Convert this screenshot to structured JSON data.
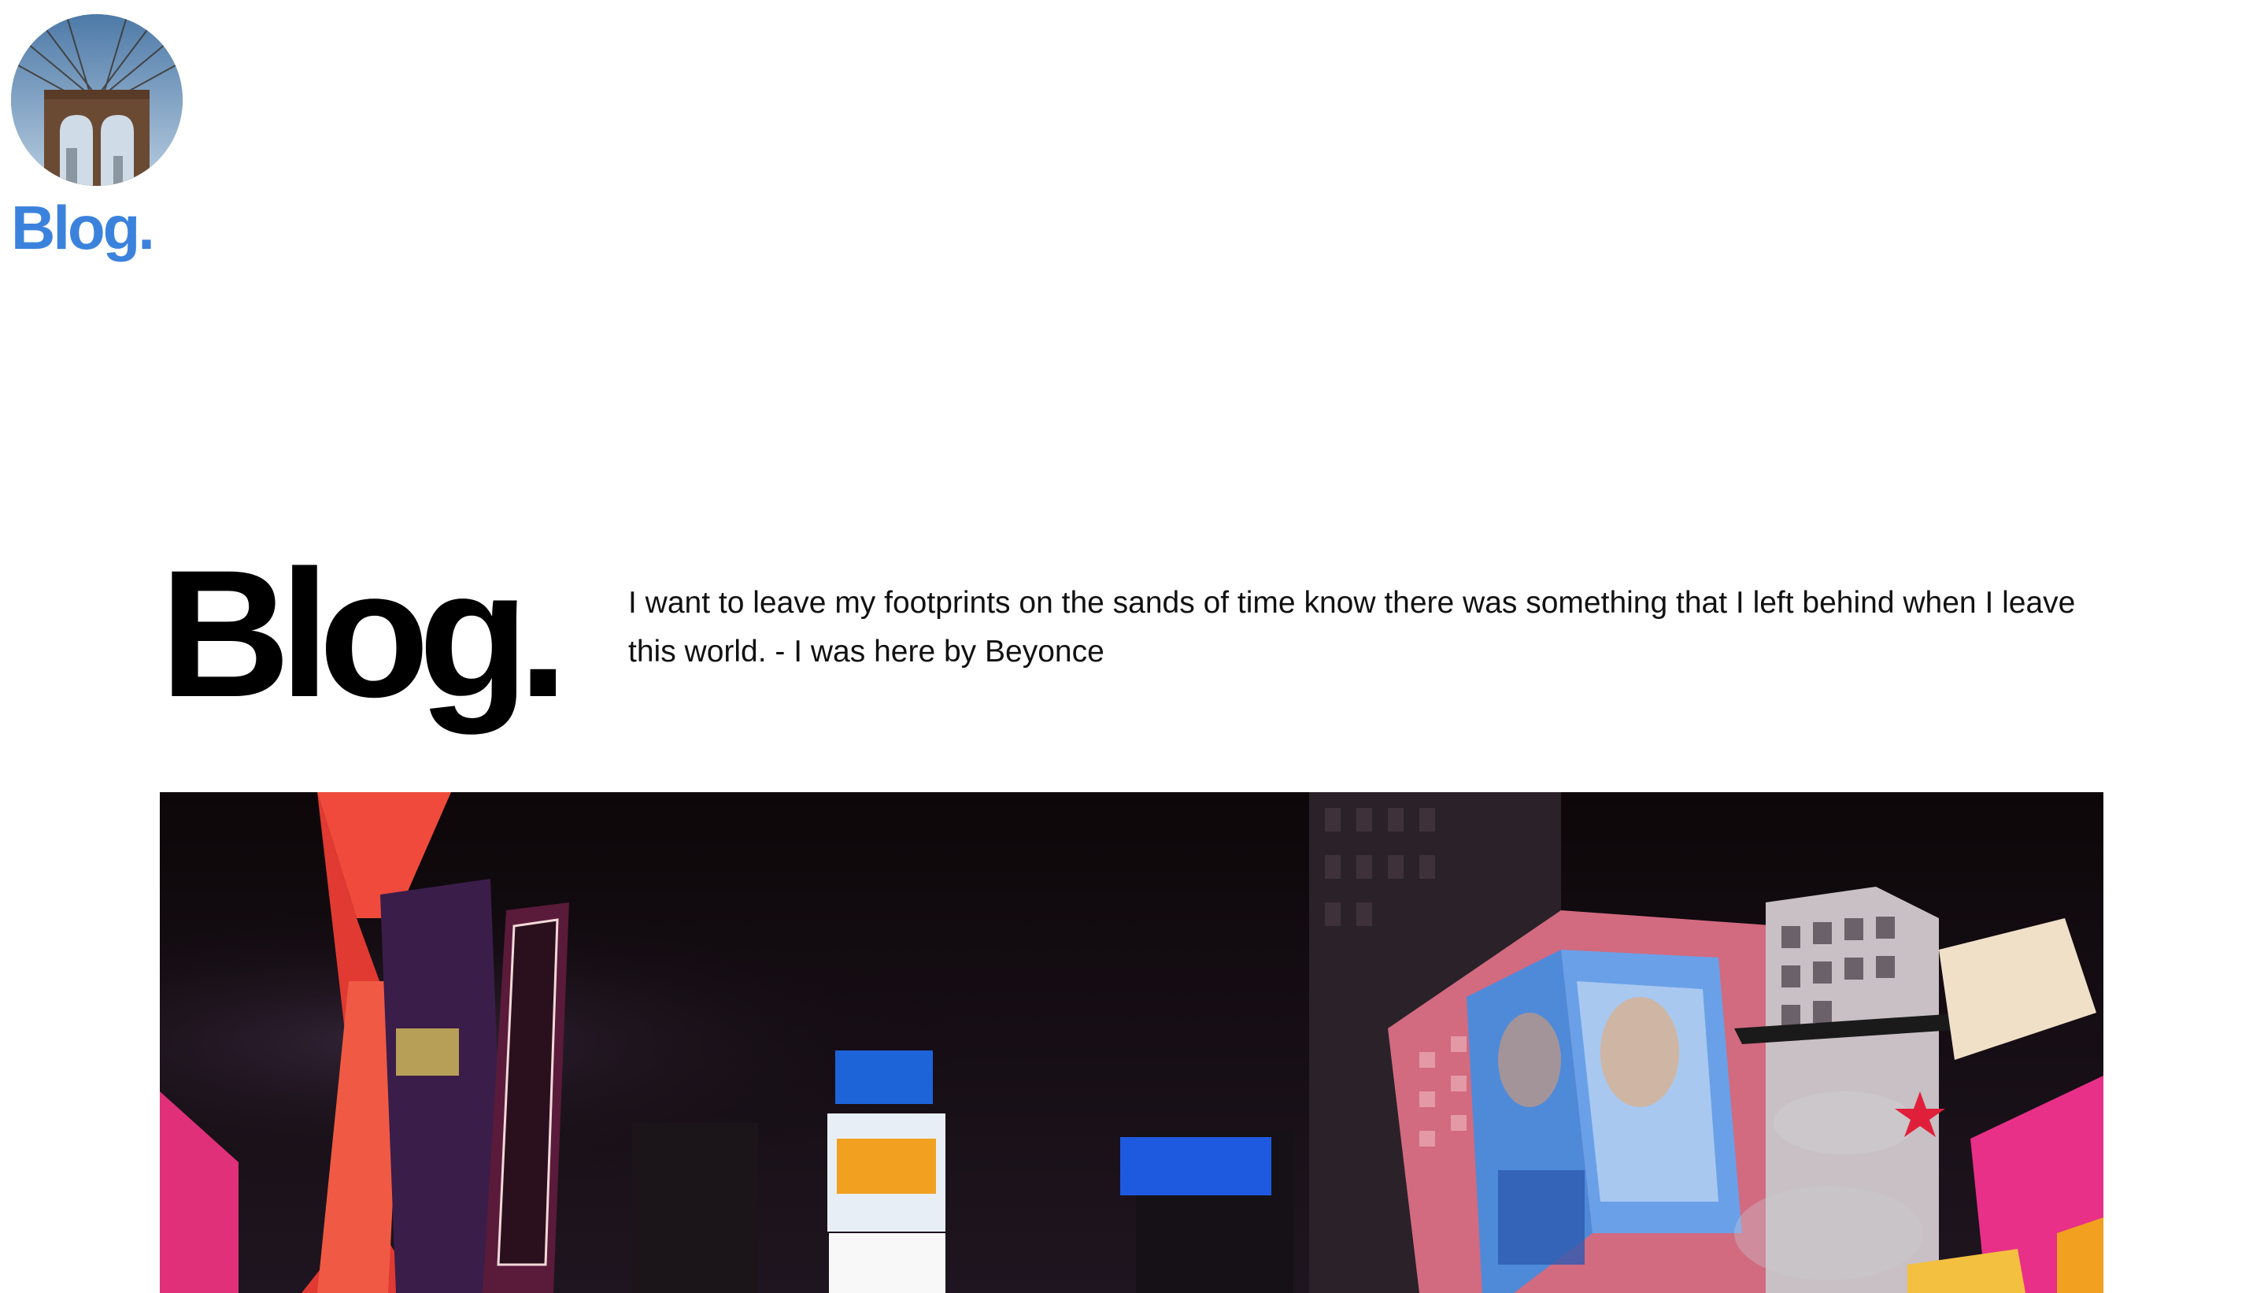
{
  "site": {
    "title": "Blog.",
    "avatar_icon": "bridge-photo-avatar",
    "accent_color": "#3b82dd"
  },
  "hero": {
    "title": "Blog.",
    "quote": "I want to leave my footprints on the sands of time know there was something that I left behind when I leave this world. - I was here by Beyonce"
  },
  "featured_image": {
    "icon": "times-square-night-photo"
  }
}
